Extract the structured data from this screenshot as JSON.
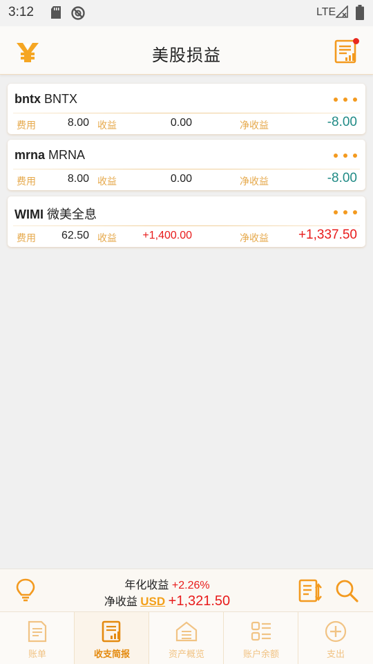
{
  "status_bar": {
    "time": "3:12",
    "network": "LTE"
  },
  "app_bar": {
    "title": "美股损益"
  },
  "labels": {
    "fee": "费用",
    "income": "收益",
    "net": "净收益"
  },
  "stocks": [
    {
      "code": "bntx",
      "name": "BNTX",
      "fee": "8.00",
      "income": "0.00",
      "net": "-8.00"
    },
    {
      "code": "mrna",
      "name": "MRNA",
      "fee": "8.00",
      "income": "0.00",
      "net": "-8.00"
    },
    {
      "code": "WIMI",
      "name": "微美全息",
      "fee": "62.50",
      "income": "+1,400.00",
      "net": "+1,337.50"
    }
  ],
  "summary": {
    "annual_label": "年化收益",
    "annual_value": "+2.26%",
    "net_label": "净收益",
    "currency": "USD",
    "net_value": "+1,321.50"
  },
  "tabs": [
    {
      "label": "账单",
      "icon": "bill-icon",
      "active": false
    },
    {
      "label": "收支简报",
      "icon": "report-icon",
      "active": true
    },
    {
      "label": "资产概览",
      "icon": "assets-icon",
      "active": false
    },
    {
      "label": "账户余额",
      "icon": "balance-icon",
      "active": false
    },
    {
      "label": "支出",
      "icon": "add-icon",
      "active": false
    }
  ],
  "colors": {
    "accent": "#f39a1f",
    "positive": "#e81b1b",
    "negative": "#1f8a85",
    "label": "#e6a94c",
    "notification": "#e8281f"
  }
}
